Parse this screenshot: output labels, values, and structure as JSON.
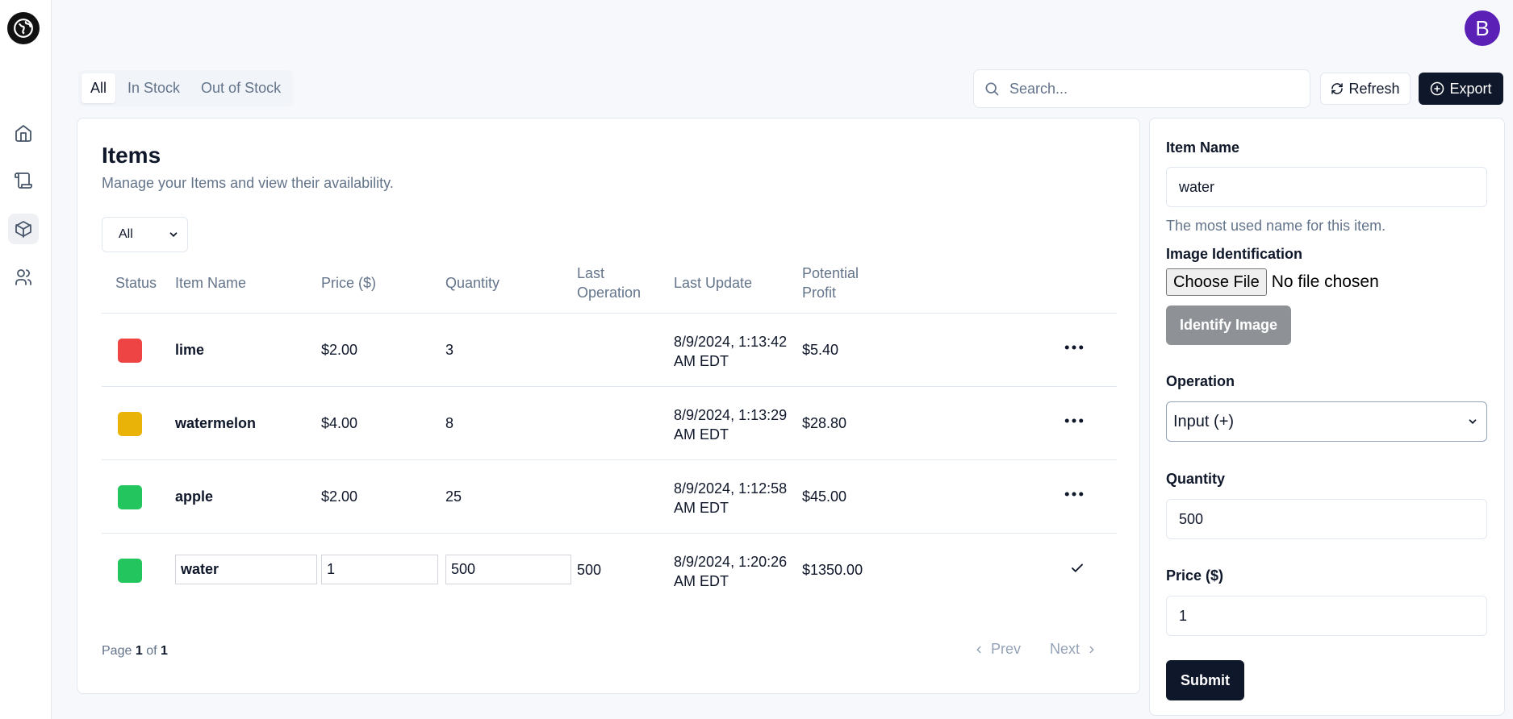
{
  "app": {
    "avatar_initial": "B"
  },
  "sidebar": {
    "items": [
      {
        "name": "home",
        "icon": "home-icon"
      },
      {
        "name": "scroll",
        "icon": "scroll-icon"
      },
      {
        "name": "items",
        "icon": "package-icon",
        "active": true
      },
      {
        "name": "users",
        "icon": "users-icon"
      }
    ]
  },
  "tabs": [
    "All",
    "In Stock",
    "Out of Stock"
  ],
  "search": {
    "placeholder": "Search..."
  },
  "toolbar": {
    "refresh_label": "Refresh",
    "export_label": "Export"
  },
  "main": {
    "title": "Items",
    "subtitle": "Manage your Items and view their availability.",
    "filter_value": "All",
    "columns": {
      "status": "Status",
      "item_name": "Item Name",
      "price": "Price ($)",
      "quantity": "Quantity",
      "last_operation_1": "Last",
      "last_operation_2": "Operation",
      "last_update": "Last Update",
      "potential_profit_1": "Potential",
      "potential_profit_2": "Profit"
    },
    "rows": [
      {
        "status_color": "#ef4444",
        "name": "lime",
        "price": "$2.00",
        "quantity": "3",
        "last_operation": "",
        "update_1": "8/9/2024, 1:13:42",
        "update_2": "AM EDT",
        "profit": "$5.40"
      },
      {
        "status_color": "#eab308",
        "name": "watermelon",
        "price": "$4.00",
        "quantity": "8",
        "last_operation": "",
        "update_1": "8/9/2024, 1:13:29",
        "update_2": "AM EDT",
        "profit": "$28.80"
      },
      {
        "status_color": "#22c55e",
        "name": "apple",
        "price": "$2.00",
        "quantity": "25",
        "last_operation": "",
        "update_1": "8/9/2024, 1:12:58",
        "update_2": "AM EDT",
        "profit": "$45.00"
      },
      {
        "status_color": "#22c55e",
        "name": "water",
        "price": "1",
        "quantity": "500",
        "last_operation": "500",
        "update_1": "8/9/2024, 1:20:26",
        "update_2": "AM EDT",
        "profit": "$1350.00"
      }
    ],
    "pagination": {
      "page_label": "Page",
      "current": "1",
      "of_label": "of",
      "total": "1",
      "prev_label": "Prev",
      "next_label": "Next"
    }
  },
  "form": {
    "item_name_label": "Item Name",
    "item_name_value": "water",
    "item_name_hint": "The most used name for this item.",
    "image_label": "Image Identification",
    "choose_file_label": "Choose File",
    "no_file_text": "No file chosen",
    "identify_label": "Identify Image",
    "operation_label": "Operation",
    "operation_value": "Input (+)",
    "quantity_label": "Quantity",
    "quantity_value": "500",
    "price_label": "Price ($)",
    "price_value": "1",
    "submit_label": "Submit"
  },
  "colors": {
    "primary": "#0f172a",
    "avatar": "#5b21b6",
    "muted": "#64748b"
  }
}
